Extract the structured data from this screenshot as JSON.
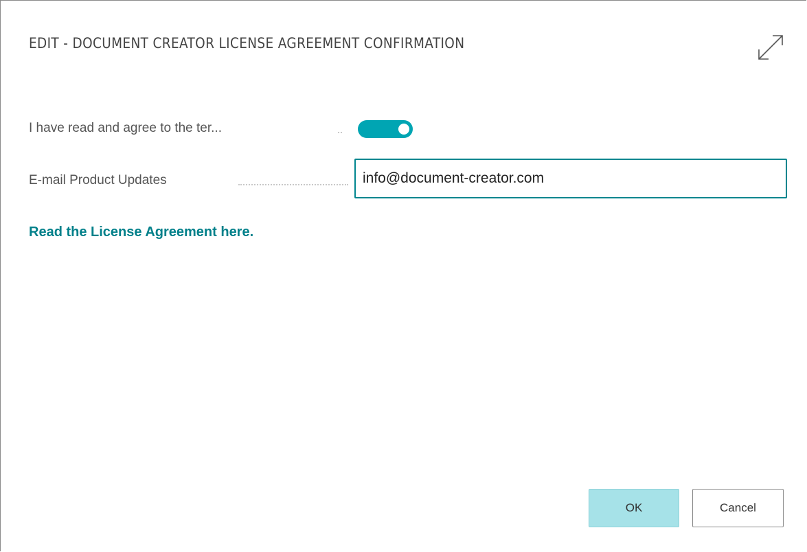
{
  "dialog": {
    "title": "EDIT - DOCUMENT CREATOR LICENSE AGREEMENT CONFIRMATION",
    "expand_icon": "expand-diagonal-arrows-icon"
  },
  "fields": {
    "agree": {
      "label": "I have read and agree to the ter...",
      "toggle_state": "on",
      "toggle_color": "#00a5b3"
    },
    "email": {
      "label": "E-mail Product Updates",
      "value": "info@document-creator.com",
      "border_color": "#00868f"
    }
  },
  "license_link": {
    "text": "Read the License Agreement here.",
    "color": "#00808a"
  },
  "buttons": {
    "ok_label": "OK",
    "cancel_label": "Cancel",
    "ok_color": "#a6e2e8"
  }
}
